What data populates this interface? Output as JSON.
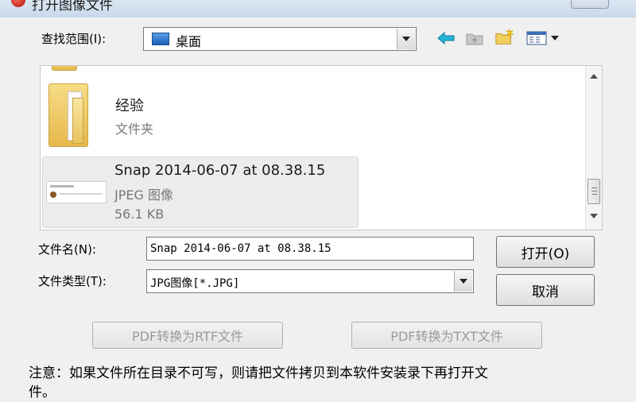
{
  "window": {
    "title": "打开图像文件"
  },
  "lookin": {
    "label": "查找范围(I):",
    "value": "桌面"
  },
  "toolbar": {
    "icons": [
      "back-arrow-icon",
      "up-folder-icon",
      "new-folder-icon",
      "view-menu-icon"
    ]
  },
  "files": [
    {
      "name": "经验",
      "type": "文件夹",
      "icon": "folder-icon"
    },
    {
      "name": "Snap 2014-06-07 at 08.38.15",
      "type": "JPEG 图像",
      "size": "56.1 KB",
      "icon": "image-thumbnail-icon"
    }
  ],
  "filename": {
    "label": "文件名(N):",
    "value": "Snap 2014-06-07 at 08.38.15"
  },
  "filetype": {
    "label": "文件类型(T):",
    "value": "JPG图像[*.JPG]"
  },
  "buttons": {
    "open": "打开(O)",
    "cancel": "取消",
    "pdf_rtf": "PDF转换为RTF文件",
    "pdf_txt": "PDF转换为TXT文件"
  },
  "note": "注意：如果文件所在目录不可写，则请把文件拷贝到本软件安装录下再打开文件。",
  "colors": {
    "dialog_bg": "#f0f0f0",
    "selected_item_bg": "#ececec",
    "folder": "#e6b84c",
    "accent_blue": "#1c5fb8"
  }
}
